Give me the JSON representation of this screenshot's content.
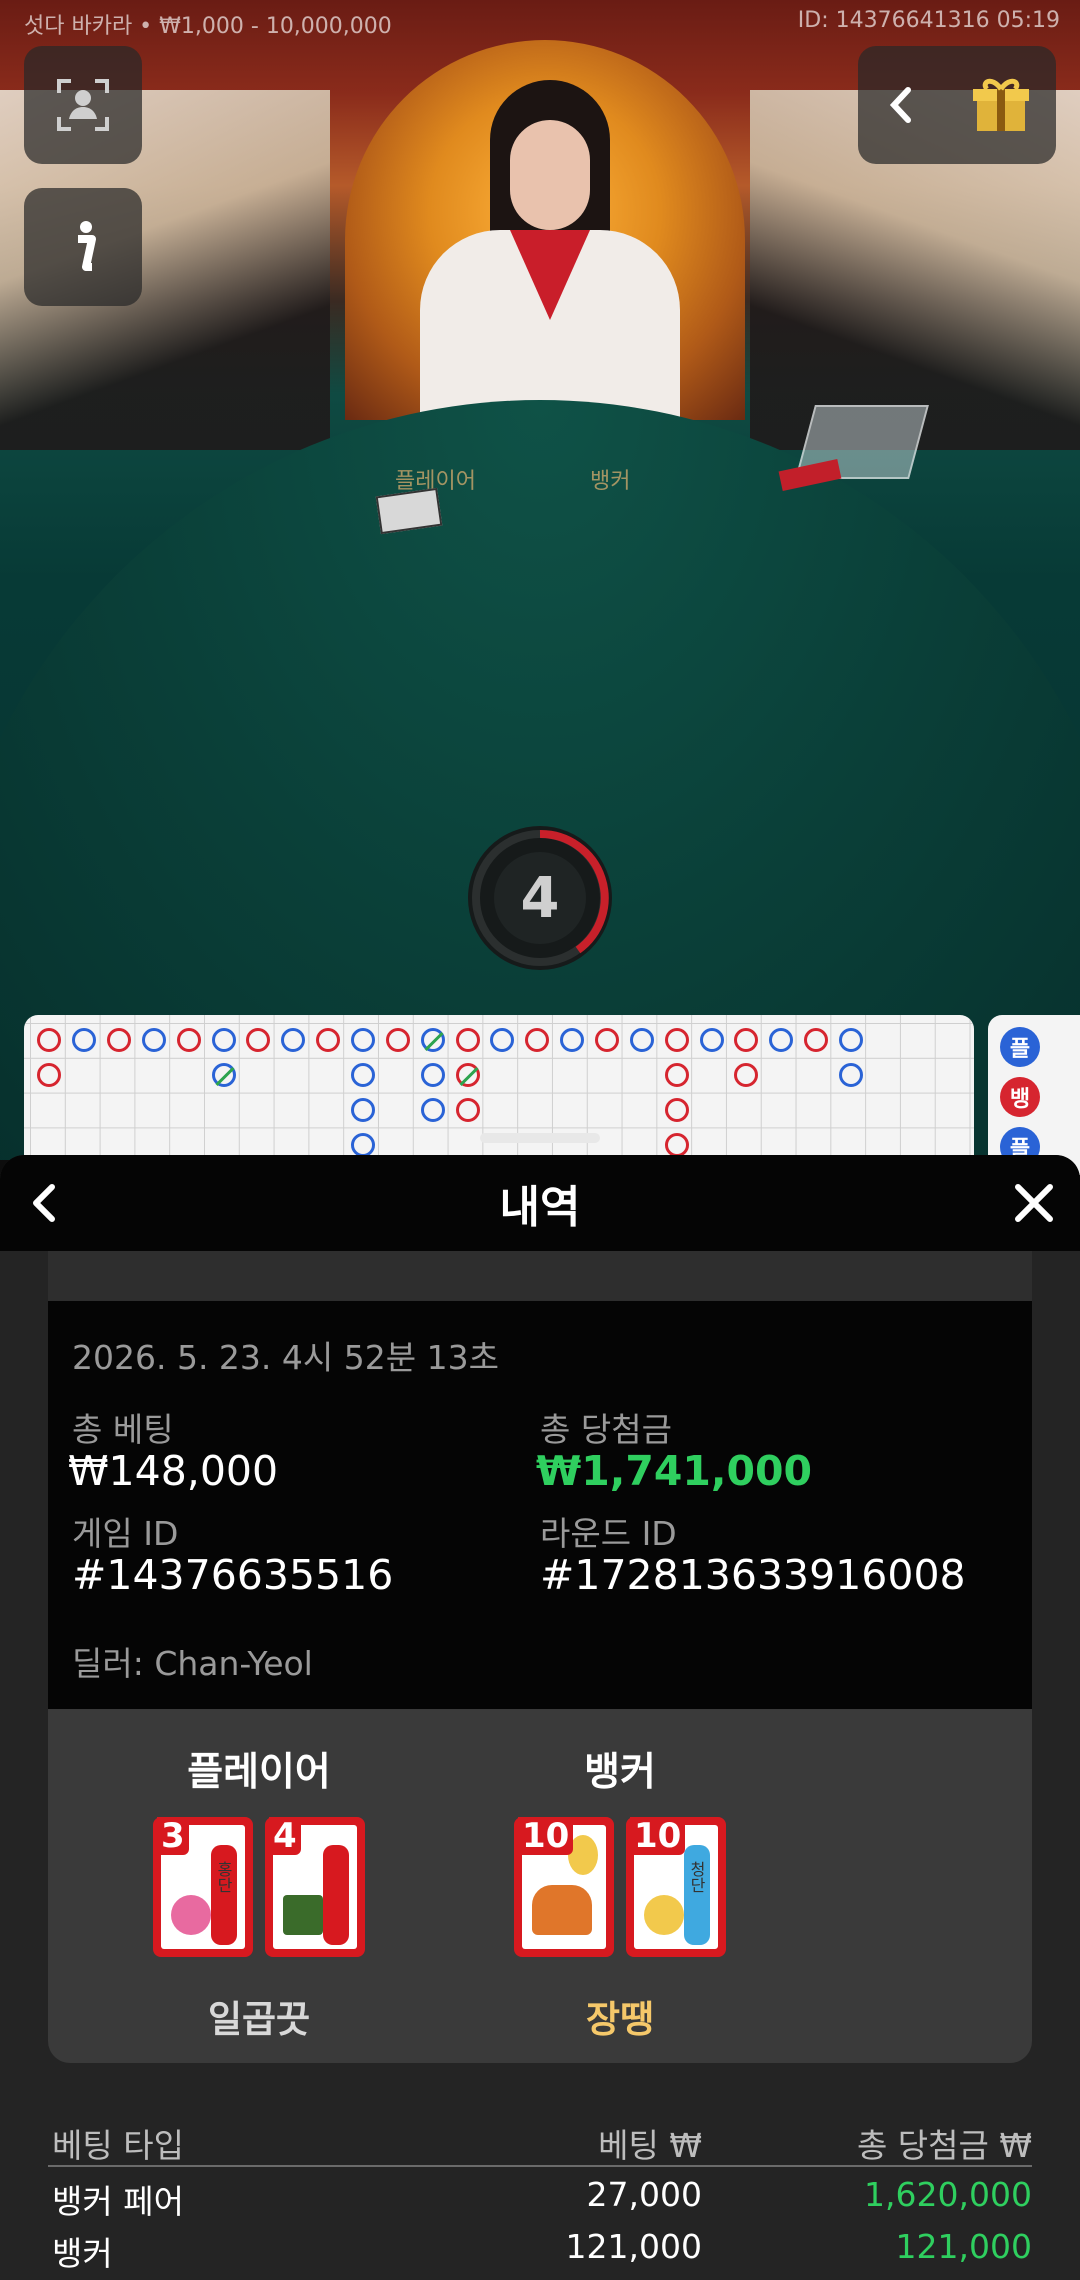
{
  "stream": {
    "table_info": "섯다 바카라 • ₩1,000 - 10,000,000",
    "game_info": "ID: 14376641316 05:19",
    "table_labels": [
      "플레이어",
      "뱅커"
    ],
    "countdown": "4"
  },
  "roadmap": {
    "side_labels": [
      "플",
      "뱅",
      "플"
    ],
    "colors": {
      "player": "#2a63d6",
      "banker": "#d6252f",
      "tie": "#2da44e"
    }
  },
  "sheet": {
    "title": "내역",
    "timestamp": "2026. 5. 23. 4시 52분 13초",
    "total_bet_label": "총 베팅",
    "total_bet_value": "₩148,000",
    "total_win_label": "총 당첨금",
    "total_win_value": "₩1,741,000",
    "game_id_label": "게임 ID",
    "game_id_value": "#14376635516",
    "round_id_label": "라운드 ID",
    "round_id_value": "#172813633916008",
    "dealer": "딜러: Chan-Yeol",
    "player": {
      "title": "플레이어",
      "cards": [
        {
          "rank": "3",
          "icon": "cherry-blossom-card-icon",
          "text": "홍단"
        },
        {
          "rank": "4",
          "icon": "wisteria-card-icon",
          "text": ""
        }
      ],
      "hand": "일곱끗",
      "hand_color": "#d8d8d8"
    },
    "banker": {
      "title": "뱅커",
      "cards": [
        {
          "rank": "10",
          "icon": "deer-maple-card-icon",
          "text": ""
        },
        {
          "rank": "10",
          "icon": "blue-ribbon-card-icon",
          "text": "청단"
        }
      ],
      "hand": "장땡",
      "hand_color": "#f5c86a"
    },
    "bets_header": {
      "type": "베팅 타입",
      "bet": "베팅 ₩",
      "win": "총 당첨금 ₩"
    },
    "bets": [
      {
        "type": "뱅커 페어",
        "bet": "27,000",
        "win": "1,620,000"
      },
      {
        "type": "뱅커",
        "bet": "121,000",
        "win": "121,000"
      }
    ],
    "win_color": "#2fcf5f"
  }
}
